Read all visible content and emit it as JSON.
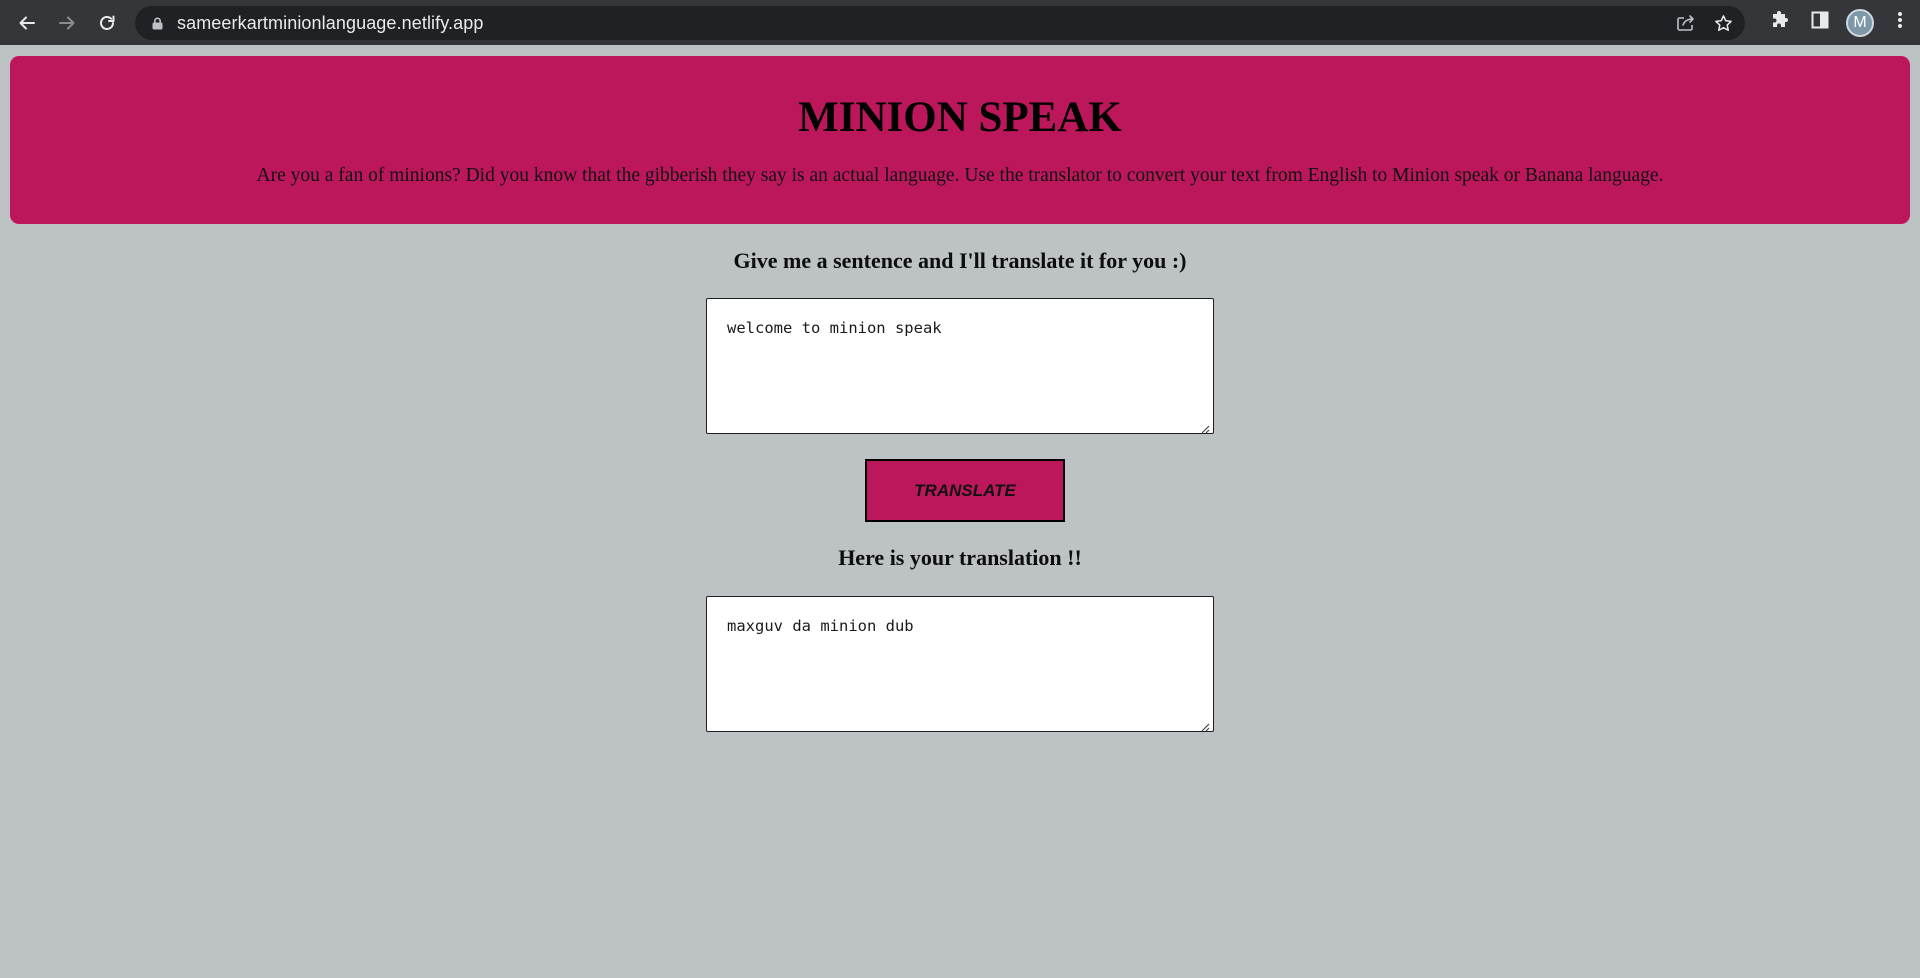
{
  "browser": {
    "url": "sameerkartminionlanguage.netlify.app",
    "profile_initial": "M",
    "icons": [
      "back-icon",
      "forward-icon",
      "reload-icon",
      "lock-icon",
      "share-icon",
      "star-icon",
      "extensions-icon",
      "side-panel-icon",
      "more-icon"
    ]
  },
  "hero": {
    "title": "MINION SPEAK",
    "description": "Are you a fan of minions? Did you know that the gibberish they say is an actual language. Use the translator to convert your text from English to Minion speak or Banana language."
  },
  "translator": {
    "prompt": "Give me a sentence and I'll translate it for you :)",
    "input_value": "welcome to minion speak",
    "button_label": "TRANSLATE",
    "result_heading": "Here is your translation !!",
    "output_value": "maxguv da minion dub"
  },
  "colors": {
    "accent": "#bd175c",
    "background": "#bdc2c5",
    "chrome": "#35363a"
  }
}
